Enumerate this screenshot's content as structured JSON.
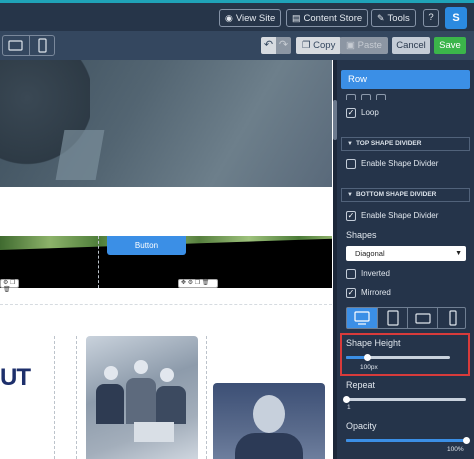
{
  "topbar": {
    "view_site": "View Site",
    "content_store": "Content Store",
    "tools": "Tools",
    "help": "?",
    "avatar_letter": "S"
  },
  "toolbar": {
    "copy_label": "Copy",
    "paste_label": "Paste",
    "cancel_label": "Cancel",
    "save_label": "Save",
    "undo_icon": "↶",
    "redo_icon": "↷"
  },
  "canvas": {
    "button_label": "Button",
    "heading_fragment": "UT"
  },
  "panel": {
    "row_label": "Row",
    "loop_label": "Loop",
    "top_divider_title": "TOP SHAPE DIVIDER",
    "enable_top_label": "Enable Shape Divider",
    "bottom_divider_title": "BOTTOM SHAPE DIVIDER",
    "enable_bottom_label": "Enable Shape Divider",
    "shapes_label": "Shapes",
    "shape_selected": "Diagonal",
    "inverted_label": "Inverted",
    "mirrored_label": "Mirrored",
    "shape_height_label": "Shape Height",
    "shape_height_value": "100px",
    "shape_height_fraction": 0.2,
    "repeat_label": "Repeat",
    "repeat_value": "1",
    "repeat_fraction": 0.0,
    "opacity_label": "Opacity",
    "opacity_value": "100%",
    "opacity_fraction": 1.0
  },
  "states": {
    "loop_checked": true,
    "enable_top_checked": false,
    "enable_bottom_checked": true,
    "inverted_checked": false,
    "mirrored_checked": true
  },
  "colors": {
    "accent": "#3b8fe6",
    "save_green": "#3bb54a",
    "panel_bg": "#25344a",
    "highlight_red": "#d83b3b"
  }
}
